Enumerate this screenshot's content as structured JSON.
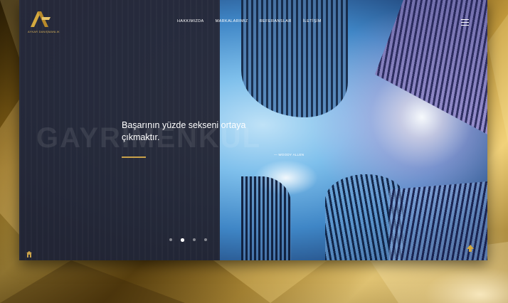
{
  "header": {
    "logo_text": "AYKAR DANIŞMANLIK",
    "nav": [
      "HAKKIMIZDA",
      "MARKALARIMIZ",
      "REFERANSLAR",
      "İLETİŞİM"
    ]
  },
  "hero": {
    "quote": "Başarının yüzde sekseni ortaya çıkmaktır.",
    "author": "— WOODY ALLEN",
    "watermark": "GAYRİMENKUL"
  },
  "slider": {
    "slide_count": 4,
    "active_index": 1
  },
  "colors": {
    "gold_accent": "#c9a24a",
    "panel_dark": "#262838"
  },
  "icons": {
    "menu": "hamburger-icon",
    "corner": "building-icon",
    "scroll": "arrow-up-icon"
  }
}
